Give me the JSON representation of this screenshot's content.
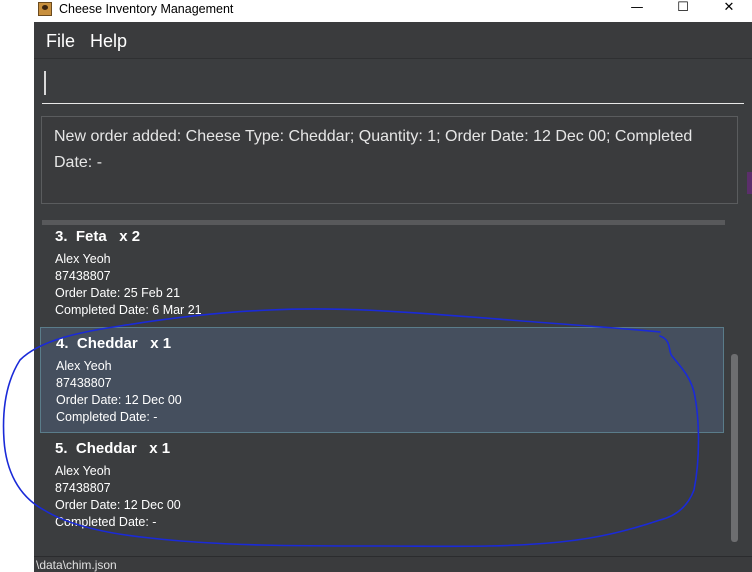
{
  "window": {
    "title": "Cheese Inventory Management",
    "minimize_glyph": "—",
    "maximize_glyph": "☐",
    "close_glyph": "✕"
  },
  "menu": {
    "items": [
      {
        "label": "File"
      },
      {
        "label": "Help"
      }
    ]
  },
  "command": {
    "value": "",
    "placeholder": ""
  },
  "result": {
    "message": "New order added: Cheese Type: Cheddar; Quantity: 1; Order Date: 12 Dec 00; Completed Date: -"
  },
  "orders": [
    {
      "index": "3.",
      "cheese": "Feta",
      "quantity": "x 2",
      "customer": "Alex Yeoh",
      "phone": "87438807",
      "order_date": "Order Date: 25 Feb 21",
      "completed_date": "Completed Date: 6 Mar 21",
      "selected": false
    },
    {
      "index": "4.",
      "cheese": "Cheddar",
      "quantity": "x 1",
      "customer": "Alex Yeoh",
      "phone": "87438807",
      "order_date": "Order Date: 12 Dec 00",
      "completed_date": "Completed Date: -",
      "selected": true
    },
    {
      "index": "5.",
      "cheese": "Cheddar",
      "quantity": "x 1",
      "customer": "Alex Yeoh",
      "phone": "87438807",
      "order_date": "Order Date: 12 Dec 00",
      "completed_date": "Completed Date: -",
      "selected": false
    }
  ],
  "status": {
    "path": "\\data\\chim.json"
  },
  "colors": {
    "background": "#3b3d3f",
    "selected_card": "#454f5e",
    "annotation_stroke": "#1a2ad8"
  },
  "icons": {
    "app": "cheese-app-icon"
  }
}
